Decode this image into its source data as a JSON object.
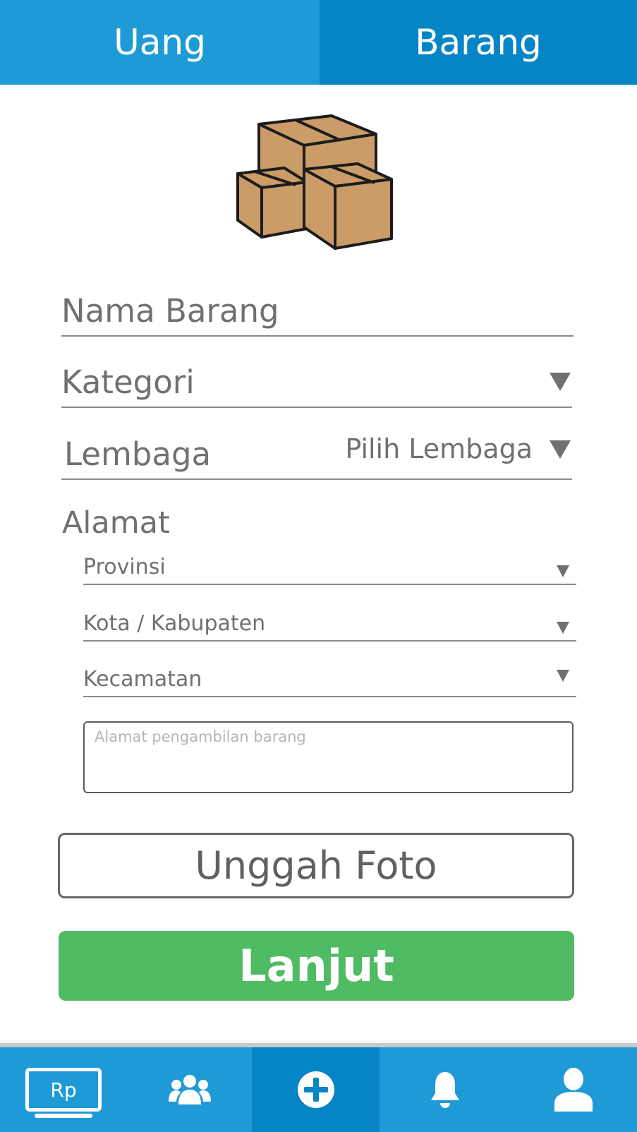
{
  "tabs": [
    {
      "label": "Uang",
      "active": false
    },
    {
      "label": "Barang",
      "active": true
    }
  ],
  "illustration": {
    "icon": "cardboard-boxes-icon"
  },
  "form": {
    "nama_barang": {
      "placeholder": "Nama Barang",
      "value": ""
    },
    "kategori": {
      "label": "Kategori"
    },
    "lembaga": {
      "label": "Lembaga",
      "value": "Pilih Lembaga"
    },
    "alamat": {
      "title": "Alamat",
      "provinsi": "Provinsi",
      "kota": "Kota / Kabupaten",
      "kecamatan": "Kecamatan",
      "pengambilan_placeholder": "Alamat pengambilan barang"
    },
    "upload_label": "Unggah Foto",
    "next_label": "Lanjut"
  },
  "bottom_nav": {
    "donasi": {
      "icon": "rp-monitor-icon",
      "text": "Rp"
    },
    "komunitas": {
      "icon": "users-icon"
    },
    "tambah": {
      "icon": "plus-circle-icon",
      "active": true
    },
    "notifikasi": {
      "icon": "bell-icon"
    },
    "profil": {
      "icon": "user-icon"
    }
  },
  "colors": {
    "tab_inactive": "#1e9ad6",
    "tab_active": "#0585c6",
    "primary_button": "#4fbb63",
    "text_gray": "#707070"
  }
}
